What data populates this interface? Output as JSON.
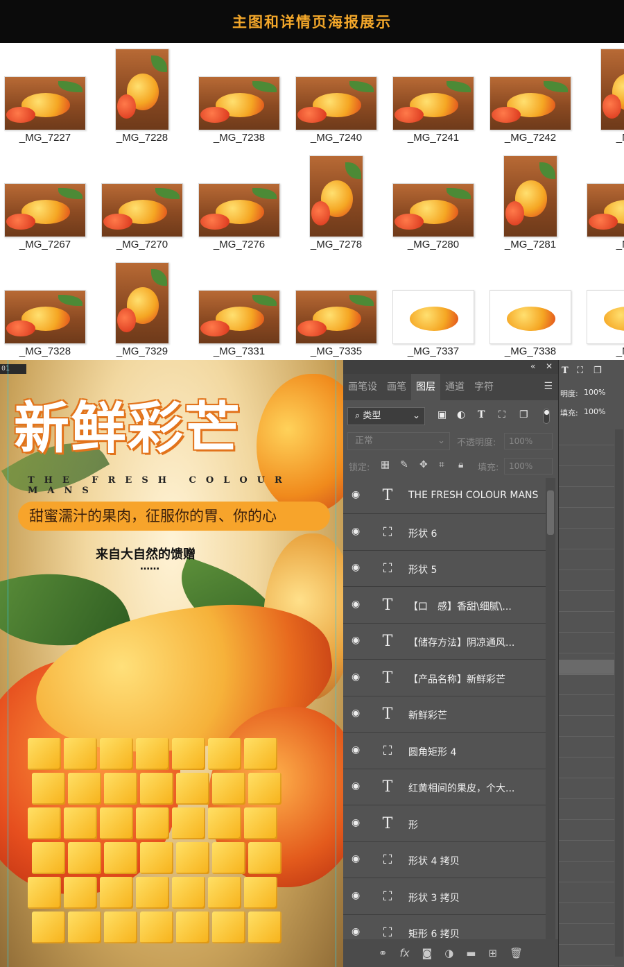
{
  "banner": {
    "title": "主图和详情页海报展示"
  },
  "grid": {
    "rows": [
      [
        "_MG_7227",
        "_MG_7228",
        "_MG_7238",
        "_MG_7240",
        "_MG_7241",
        "_MG_7242",
        "_MG"
      ],
      [
        "_MG_7267",
        "_MG_7270",
        "_MG_7276",
        "_MG_7278",
        "_MG_7280",
        "_MG_7281",
        "_MG"
      ],
      [
        "_MG_7328",
        "_MG_7329",
        "_MG_7331",
        "_MG_7335",
        "_MG_7337",
        "_MG_7338",
        "_MG"
      ]
    ]
  },
  "canvas": {
    "doc_tab": "01",
    "poster": {
      "title": "新鲜彩芒",
      "subtitle": "THE FRESH COLOUR MANS",
      "pill": "甜蜜濡汁的果肉，征服你的胃、你的心",
      "gift": "来自大自然的馈赠",
      "dots": "……"
    }
  },
  "panel": {
    "tabs": [
      "画笔设",
      "画笔",
      "图层",
      "通道",
      "字符"
    ],
    "active_tab": "图层",
    "filter_label": "类型",
    "blend_mode": "正常",
    "opacity_label": "不透明度:",
    "opacity_value": "100%",
    "lock_label": "锁定:",
    "fill_label": "填充:",
    "fill_value": "100%",
    "layers": [
      {
        "type": "text",
        "name": "THE FRESH COLOUR MANS"
      },
      {
        "type": "shape",
        "name": "形状 6"
      },
      {
        "type": "shape",
        "name": "形状 5"
      },
      {
        "type": "text",
        "name": "【口　感】香甜\\细腻\\..."
      },
      {
        "type": "text",
        "name": "【储存方法】阴凉通风..."
      },
      {
        "type": "text",
        "name": "【产品名称】新鲜彩芒"
      },
      {
        "type": "text",
        "name": "新鲜彩芒"
      },
      {
        "type": "shape",
        "name": "圆角矩形 4"
      },
      {
        "type": "text",
        "name": "红黄相间的果皮，个大..."
      },
      {
        "type": "text",
        "name": "形"
      },
      {
        "type": "shape",
        "name": "形状 4 拷贝"
      },
      {
        "type": "shape",
        "name": "形状 3 拷贝"
      },
      {
        "type": "shape",
        "name": "矩形 6 拷贝"
      }
    ]
  },
  "props": {
    "opacity_label": "明度:",
    "opacity_value": "100%",
    "fill_label": "填充:",
    "fill_value": "100%"
  }
}
